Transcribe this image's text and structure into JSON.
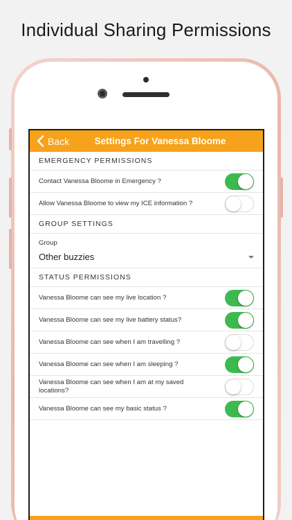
{
  "headline": "Individual Sharing Permissions",
  "colors": {
    "accent": "#f7a21b",
    "toggle_on": "#3dba4f"
  },
  "navbar": {
    "back_label": "Back",
    "back_icon": "chevron-left-icon",
    "title": "Settings For Vanessa Bloome"
  },
  "emergency": {
    "header": "EMERGENCY PERMISSIONS",
    "items": [
      {
        "label": "Contact Vanessa Bloome in Emergency ?",
        "on": true
      },
      {
        "label": "Allow Vanessa Bloome to view my ICE information ?",
        "on": false
      }
    ]
  },
  "group": {
    "header": "GROUP SETTINGS",
    "label": "Group",
    "value": "Other buzzies"
  },
  "status": {
    "header": "STATUS PERMISSIONS",
    "items": [
      {
        "label": "Vanessa Bloome can see my live location ?",
        "on": true
      },
      {
        "label": "Vanessa Bloome can see my live battery status?",
        "on": true
      },
      {
        "label": "Vanessa Bloome can see when I am travelling ?",
        "on": false
      },
      {
        "label": "Vanessa Bloome can see when I am sleeping ?",
        "on": true
      },
      {
        "label": "Vanessa Bloome can see when I am at my saved locations?",
        "on": false
      },
      {
        "label": "Vanessa Bloome can see my basic status ?",
        "on": true
      }
    ]
  }
}
